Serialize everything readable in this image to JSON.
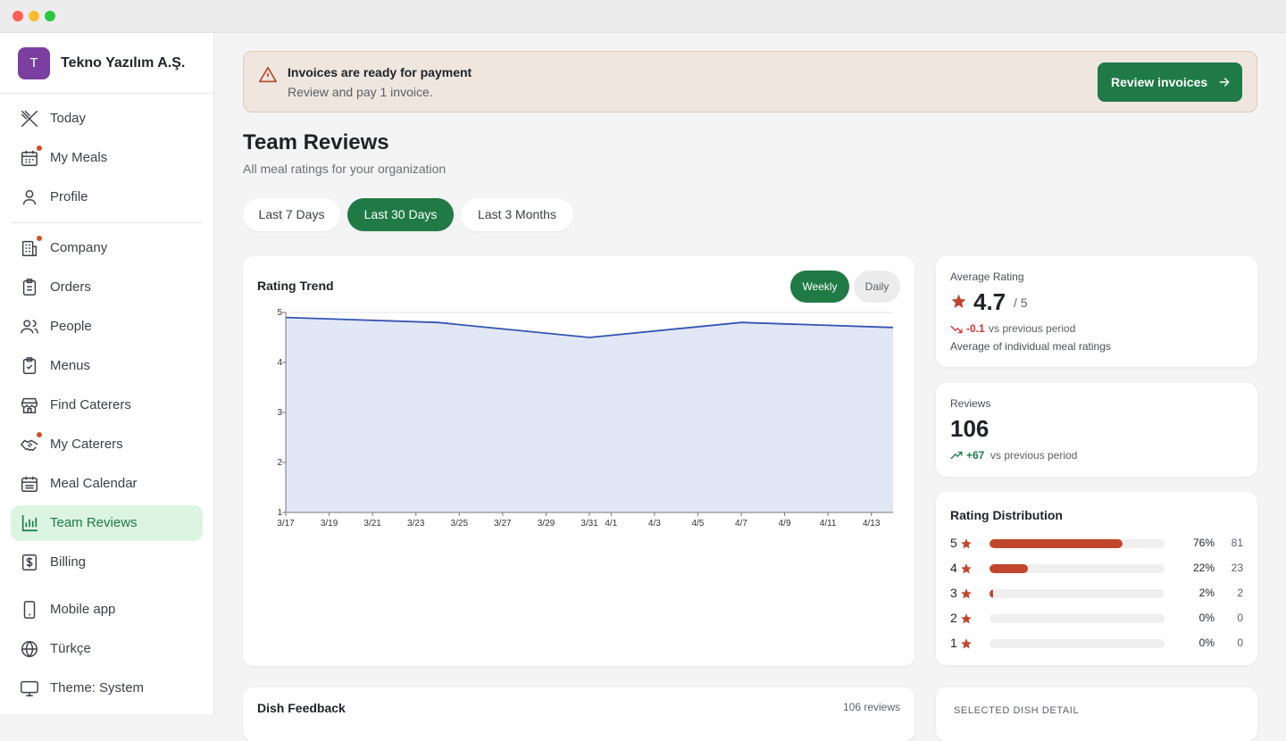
{
  "window": {
    "controls": [
      "close",
      "minimize",
      "maximize"
    ]
  },
  "org": {
    "initial": "T",
    "name": "Tekno Yazılım A.Ş.",
    "avatar_color": "#7b3fa0"
  },
  "nav": {
    "group1": [
      {
        "label": "Today",
        "icon": "utensils-crossed-icon",
        "dot": false
      },
      {
        "label": "My Meals",
        "icon": "calendar-icon",
        "dot": true
      },
      {
        "label": "Profile",
        "icon": "user-icon",
        "dot": false
      }
    ],
    "group2": [
      {
        "label": "Company",
        "icon": "building-icon",
        "dot": true
      },
      {
        "label": "Orders",
        "icon": "clipboard-list-icon",
        "dot": false
      },
      {
        "label": "People",
        "icon": "users-icon",
        "dot": false
      },
      {
        "label": "Menus",
        "icon": "clipboard-check-icon",
        "dot": false
      },
      {
        "label": "Find Caterers",
        "icon": "store-icon",
        "dot": false
      },
      {
        "label": "My Caterers",
        "icon": "handshake-icon",
        "dot": true
      },
      {
        "label": "Meal Calendar",
        "icon": "calendar-days-icon",
        "dot": false
      },
      {
        "label": "Team Reviews",
        "icon": "bar-chart-icon",
        "dot": false,
        "active": true
      },
      {
        "label": "Billing",
        "icon": "receipt-icon",
        "dot": false
      }
    ],
    "group3": [
      {
        "label": "Mobile app",
        "icon": "smartphone-icon"
      },
      {
        "label": "Türkçe",
        "icon": "globe-icon"
      },
      {
        "label": "Theme: System",
        "icon": "monitor-icon"
      }
    ]
  },
  "alert": {
    "title": "Invoices are ready for payment",
    "subtitle": "Review and pay 1 invoice.",
    "button": "Review invoices",
    "icon": "alert-triangle-icon"
  },
  "page": {
    "title": "Team Reviews",
    "subtitle": "All meal ratings for your organization"
  },
  "range_tabs": [
    {
      "label": "Last 7 Days",
      "active": false
    },
    {
      "label": "Last 30 Days",
      "active": true
    },
    {
      "label": "Last 3 Months",
      "active": false
    }
  ],
  "trend": {
    "title": "Rating Trend",
    "toggle": [
      "Weekly",
      "Daily"
    ],
    "active_toggle": "Weekly"
  },
  "chart_data": {
    "type": "area",
    "title": "Rating Trend",
    "x": [
      "3/17",
      "3/24",
      "3/31",
      "4/7",
      "4/14"
    ],
    "y": [
      4.9,
      4.8,
      4.5,
      4.8,
      4.7
    ],
    "x_ticks": [
      "3/17",
      "3/19",
      "3/21",
      "3/23",
      "3/25",
      "3/27",
      "3/29",
      "3/31",
      "4/1",
      "4/3",
      "4/5",
      "4/7",
      "4/9",
      "4/11",
      "4/13"
    ],
    "y_ticks": [
      1,
      2,
      3,
      4,
      5
    ],
    "ylim": [
      1,
      5
    ],
    "line_color": "#3553b3",
    "fill_color": "#e2e7f5",
    "grid": true
  },
  "avg_rating": {
    "label": "Average Rating",
    "value": "4.7",
    "max": "/ 5",
    "delta": "-0.1",
    "delta_text": "vs previous period",
    "note": "Average of individual meal ratings",
    "delta_color": "#d0312d"
  },
  "reviews": {
    "label": "Reviews",
    "value": "106",
    "delta": "+67",
    "delta_text": "vs previous period",
    "delta_color": "#1f7a45"
  },
  "distribution": {
    "title": "Rating Distribution",
    "rows": [
      {
        "stars": "5",
        "pct": "76%",
        "count": "81",
        "fraction": 0.76
      },
      {
        "stars": "4",
        "pct": "22%",
        "count": "23",
        "fraction": 0.22
      },
      {
        "stars": "3",
        "pct": "2%",
        "count": "2",
        "fraction": 0.02
      },
      {
        "stars": "2",
        "pct": "0%",
        "count": "0",
        "fraction": 0
      },
      {
        "stars": "1",
        "pct": "0%",
        "count": "0",
        "fraction": 0
      }
    ],
    "bar_color": "#c2452d"
  },
  "dish_feedback": {
    "title": "Dish Feedback",
    "count": "106 reviews"
  },
  "selected_dish": {
    "title": "SELECTED DISH DETAIL"
  }
}
